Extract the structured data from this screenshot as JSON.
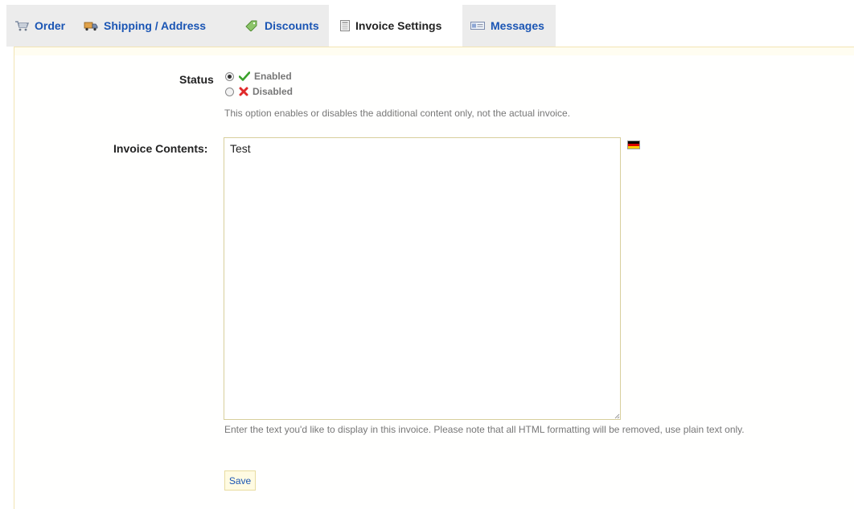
{
  "tabs": [
    {
      "label": "Order",
      "icon": "cart-icon",
      "active": false
    },
    {
      "label": "Shipping / Address",
      "icon": "truck-icon",
      "active": false
    },
    {
      "label": "Discounts",
      "icon": "discount-tag-icon",
      "active": false
    },
    {
      "label": "Invoice Settings",
      "icon": "invoice-icon",
      "active": true
    },
    {
      "label": "Messages",
      "icon": "messages-icon",
      "active": false
    }
  ],
  "status": {
    "label": "Status",
    "options": [
      {
        "label": "Enabled",
        "icon": "check-icon",
        "selected": true
      },
      {
        "label": "Disabled",
        "icon": "x-icon",
        "selected": false
      }
    ],
    "hint": "This option enables or disables the additional content only, not the actual invoice."
  },
  "invoice_contents": {
    "label": "Invoice Contents:",
    "value": "Test",
    "language_flag": "german-flag-icon",
    "hint": "Enter the text you'd like to display in this invoice. Please note that all HTML formatting will be removed, use plain text only."
  },
  "save_label": "Save",
  "colors": {
    "tab_link": "#1a55b4",
    "panel_border": "#f2e4b3",
    "hint_text": "#777777"
  }
}
